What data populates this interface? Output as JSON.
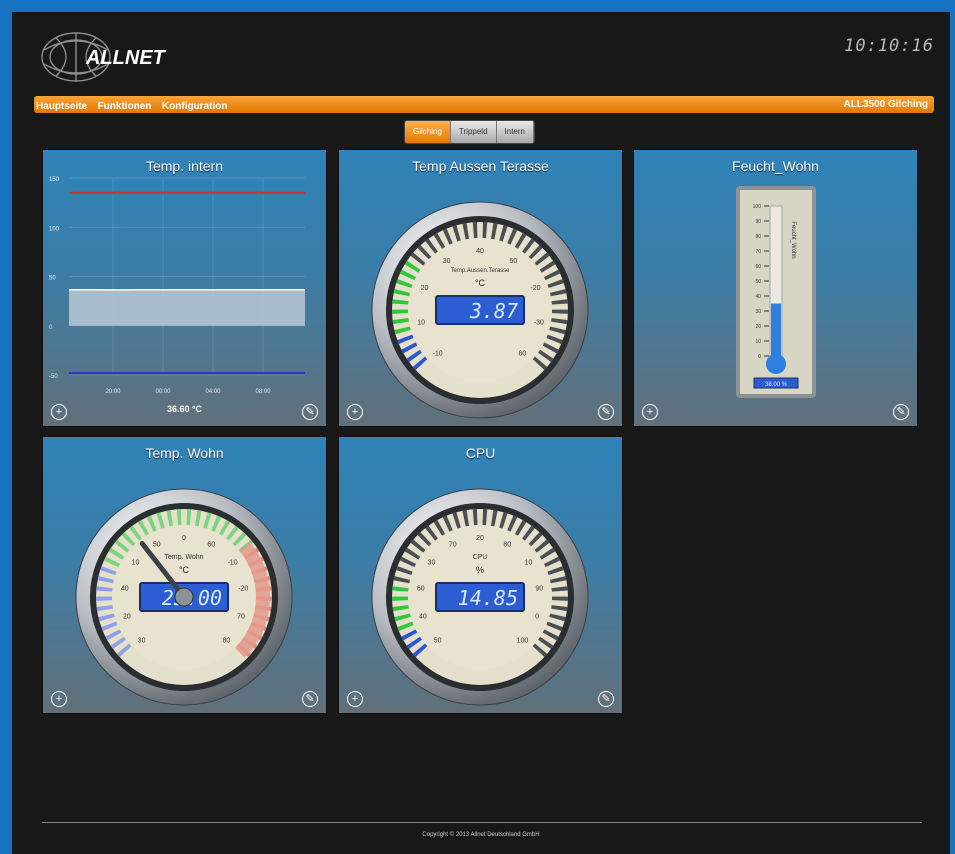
{
  "header": {
    "brand": "ALLNET",
    "clock": "10:10:16"
  },
  "nav": {
    "items": [
      "Hauptseite",
      "Funktionen",
      "Konfiguration"
    ],
    "device": "ALL3500 Gilching"
  },
  "tabs": [
    {
      "label": "Gilching",
      "active": true
    },
    {
      "label": "Trippeld",
      "active": false
    },
    {
      "label": "Intern",
      "active": false
    }
  ],
  "widgets": {
    "temp_intern": {
      "title": "Temp. intern",
      "readout": "36.60 °C",
      "chart_data": {
        "type": "area",
        "y_ticks": [
          "150",
          "100",
          "50",
          "0",
          "-50"
        ],
        "x_ticks": [
          "20:00",
          "00:00",
          "04:00",
          "08:00"
        ],
        "ylim": [
          -50,
          150
        ],
        "upper_limit": 135,
        "lower_limit": -48,
        "values": [
          36.5,
          36.5,
          36.4,
          36.5,
          36.6,
          36.5,
          36.5,
          36.6,
          36.6,
          36.5,
          36.6,
          36.6
        ],
        "colors": {
          "area": "#b9c9d3",
          "upper": "#c8332e",
          "lower": "#2a32d6"
        }
      }
    },
    "temp_aussen": {
      "title": "Temp Aussen Terasse",
      "label": "Temp.Aussen.Terasse",
      "unit": "°C",
      "value": "3.87",
      "ticks": [
        "-10",
        "10",
        "20",
        "30",
        "40",
        "50",
        "-20",
        "-30",
        "60"
      ]
    },
    "feucht_wohn": {
      "title": "Feucht_Wohn",
      "label": "Feucht_Wohn",
      "fill": 0.35,
      "ticks": [
        "100",
        "90",
        "80",
        "70",
        "60",
        "50",
        "40",
        "30",
        "20",
        "10",
        "0"
      ],
      "readout": "38.00 %"
    },
    "temp_wohn": {
      "title": "Temp. Wohn",
      "label": "Temp. Wohn",
      "unit": "°C",
      "value": "23.00",
      "ticks": [
        "30",
        "20",
        "40",
        "10",
        "50",
        "0",
        "60",
        "-10",
        "-20",
        "70",
        "80"
      ]
    },
    "cpu": {
      "title": "CPU",
      "label": "CPU",
      "unit": "%",
      "value": "14.85",
      "ticks": [
        "50",
        "40",
        "60",
        "30",
        "70",
        "20",
        "80",
        "10",
        "90",
        "0",
        "100"
      ]
    }
  },
  "footer": {
    "copyright": "Copyright © 2013 Allnet Deutschland GmbH"
  }
}
